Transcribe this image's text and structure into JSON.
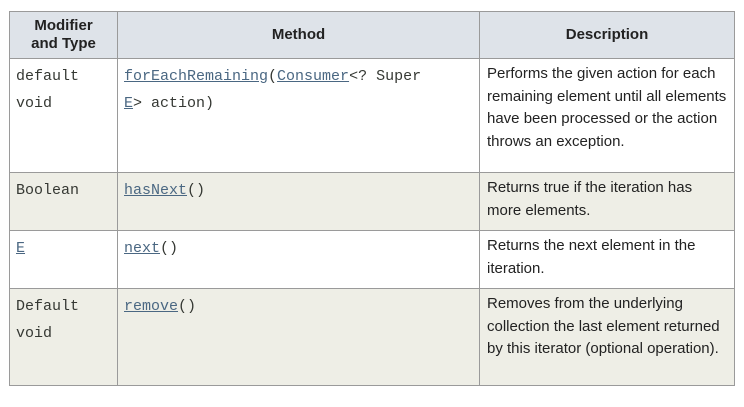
{
  "headers": {
    "modifier_line1": "Modifier",
    "modifier_line2": "and Type",
    "method": "Method",
    "description": "Description"
  },
  "rows": [
    {
      "modifier_line1": "default",
      "modifier_line2": "void",
      "method_name": "forEachRemaining",
      "param_type": "Consumer",
      "param_mid": "<? Super",
      "param_generic": "E",
      "param_rest": "> action)",
      "description": "Performs the given action for each remaining element until all elements have been processed or the action throws an exception."
    },
    {
      "modifier": "Boolean",
      "method_name": "hasNext",
      "method_parens": "()",
      "description": "Returns true if the iteration has more elements."
    },
    {
      "modifier": "E",
      "method_name": "next",
      "method_parens": "()",
      "description": "Returns the next element in the iteration."
    },
    {
      "modifier_line1": "Default",
      "modifier_line2": "void",
      "method_name": "remove",
      "method_parens": "()",
      "description": "Removes from the underlying collection the last element returned by this iterator (optional operation)."
    }
  ]
}
